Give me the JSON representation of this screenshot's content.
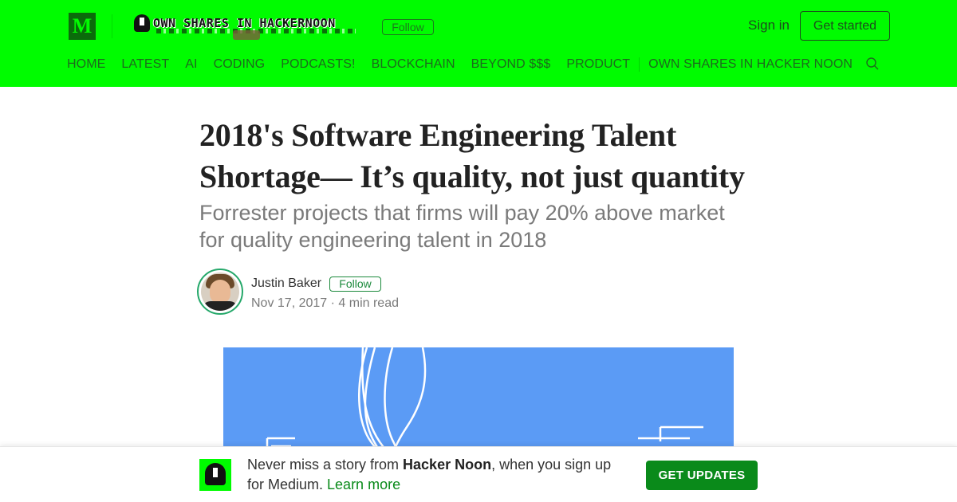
{
  "header": {
    "logo_letter": "M",
    "publication_name": "OWN SHARES IN HACKERNOON",
    "follow_label": "Follow",
    "sign_in_label": "Sign in",
    "get_started_label": "Get started",
    "brand_color": "#00fc00"
  },
  "nav": {
    "items": [
      "HOME",
      "LATEST",
      "AI",
      "CODING",
      "PODCASTS!",
      "BLOCKCHAIN",
      "BEYOND $$$",
      "PRODUCT",
      "OWN SHARES IN HACKER NOON"
    ],
    "search_icon": "search-icon"
  },
  "article": {
    "title": "2018's Software Engineering Talent Shortage— It’s quality, not just quantity",
    "subtitle": "Forrester projects that firms will pay 20% above market for quality engineering talent in 2018",
    "author": {
      "name": "Justin Baker",
      "follow_label": "Follow",
      "meta": "Nov 17, 2017 · 4 min read"
    },
    "hero_color": "#5b9bf5"
  },
  "banner": {
    "text_prefix": "Never miss a story from ",
    "publication": "Hacker Noon",
    "text_suffix": ", when you sign up for Medium. ",
    "learn_more": "Learn more",
    "cta_label": "GET UPDATES",
    "cta_color": "#0a8a1a"
  }
}
